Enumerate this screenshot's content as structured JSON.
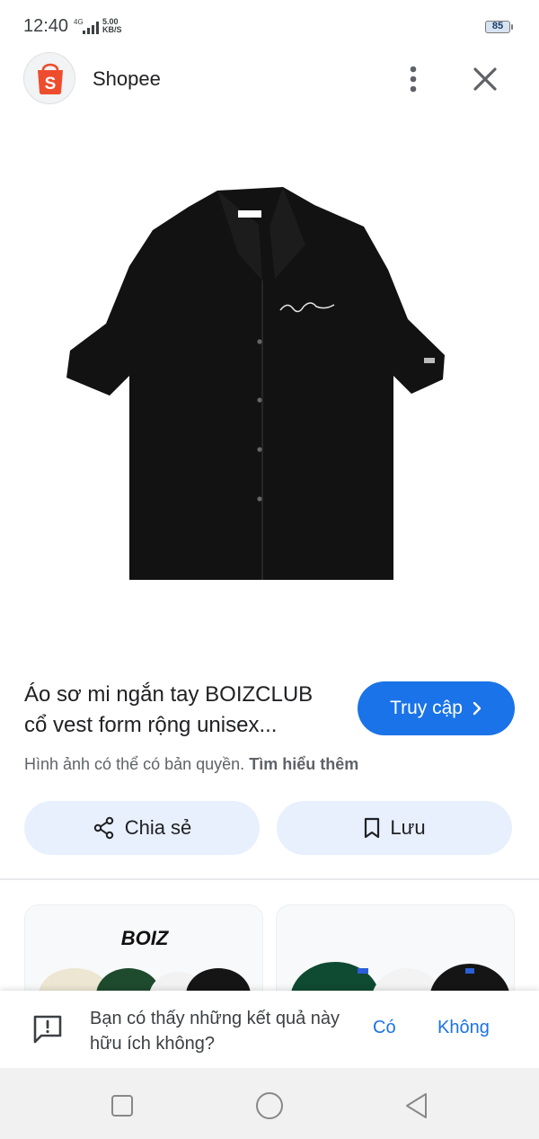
{
  "status_bar": {
    "time": "12:40",
    "network": "4G",
    "speed_value": "5.00",
    "speed_unit": "KB/S",
    "battery": "85"
  },
  "app_header": {
    "title": "Shopee",
    "icons": [
      "shopee-logo-icon",
      "more-vert-icon",
      "close-icon"
    ],
    "brand_color": "#ee4d2d"
  },
  "product": {
    "image_desc_icon": "black-shirt-image",
    "title": "Áo sơ mi ngắn tay BOIZCLUB cổ vest form rộng unisex...",
    "visit_label": "Truy cập",
    "copyright_text": "Hình ảnh có thể có bản quyền.",
    "learn_more": "Tìm hiểu thêm",
    "accent_color": "#1a73e8"
  },
  "actions": {
    "share_label": "Chia sẻ",
    "save_label": "Lưu"
  },
  "related": {
    "card1_logo": "BOIZ"
  },
  "feedback": {
    "question": "Bạn có thấy những kết quả này hữu ích không?",
    "yes_label": "Có",
    "no_label": "Không"
  },
  "nav_bar": {
    "icons": [
      "recents-square-icon",
      "home-circle-icon",
      "back-triangle-icon"
    ]
  }
}
